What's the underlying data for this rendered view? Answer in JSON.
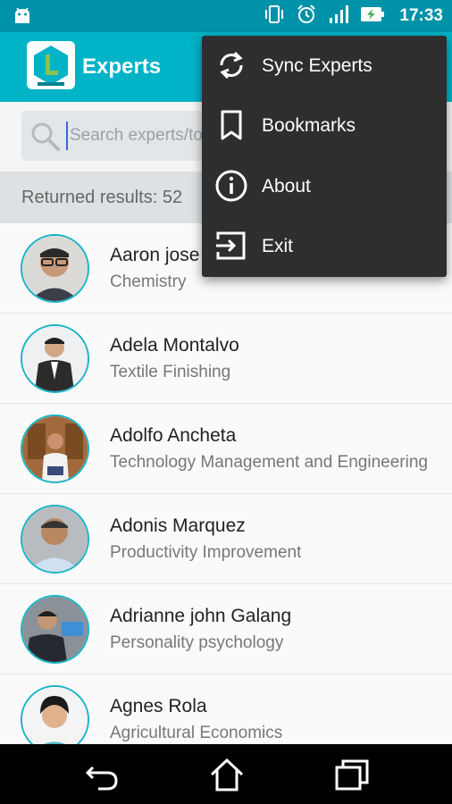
{
  "status_bar": {
    "time": "17:33",
    "icons": [
      "android-icon",
      "vibrate-icon",
      "alarm-icon",
      "signal-icon",
      "battery-charging-icon"
    ]
  },
  "app_bar": {
    "title": "Experts",
    "logo": "app-logo"
  },
  "search": {
    "placeholder": "Search experts/topics",
    "value": ""
  },
  "results": {
    "text": "Returned results: 52"
  },
  "experts": [
    {
      "name": "Aaron jose",
      "field": "Chemistry"
    },
    {
      "name": "Adela Montalvo",
      "field": "Textile Finishing"
    },
    {
      "name": "Adolfo Ancheta",
      "field": "Technology Management and Engineering"
    },
    {
      "name": "Adonis Marquez",
      "field": "Productivity Improvement"
    },
    {
      "name": "Adrianne john Galang",
      "field": "Personality psychology"
    },
    {
      "name": "Agnes Rola",
      "field": "Agricultural Economics"
    }
  ],
  "menu": {
    "items": [
      {
        "label": "Sync Experts",
        "icon": "sync-icon"
      },
      {
        "label": "Bookmarks",
        "icon": "bookmark-icon"
      },
      {
        "label": "About",
        "icon": "info-icon"
      },
      {
        "label": "Exit",
        "icon": "exit-icon"
      }
    ]
  },
  "nav_bar": {
    "buttons": [
      "back-icon",
      "home-icon",
      "recents-icon"
    ]
  },
  "colors": {
    "status_bar": "#0092a8",
    "app_bar": "#00b3c7",
    "menu_bg": "#2e2e2e",
    "avatar_ring": "#17b5c6"
  }
}
